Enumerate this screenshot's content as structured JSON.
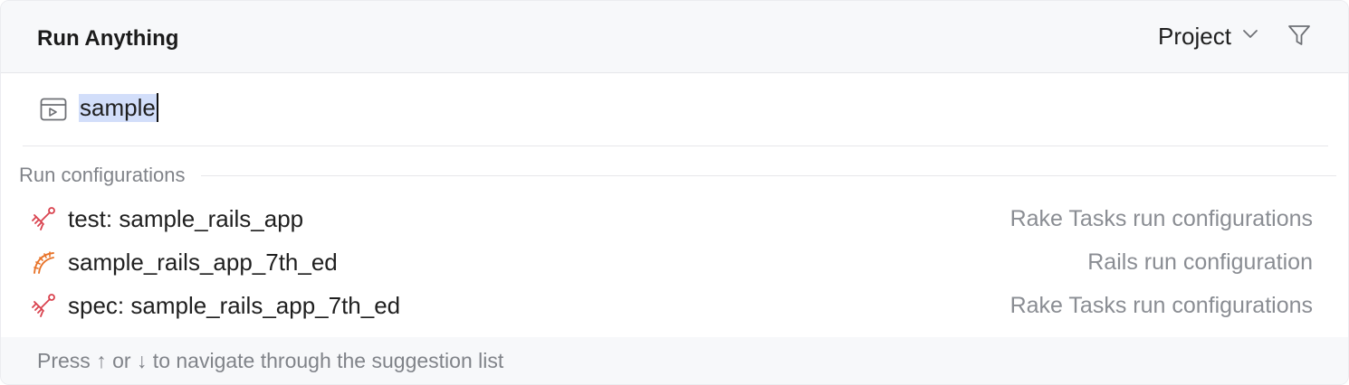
{
  "header": {
    "title": "Run Anything",
    "scope_label": "Project",
    "scope_icon": "chevron-down-icon",
    "filter_icon": "filter-icon"
  },
  "search": {
    "icon": "run-terminal-icon",
    "value": "sample"
  },
  "section": {
    "label": "Run configurations"
  },
  "items": [
    {
      "name": "test: sample_rails_app",
      "type": "Rake Tasks run configurations",
      "icon": "rake-icon",
      "icon_color": "#d9424e"
    },
    {
      "name": "sample_rails_app_7th_ed",
      "type": "Rails run configuration",
      "icon": "rails-icon",
      "icon_color": "#e8742a"
    },
    {
      "name": "spec: sample_rails_app_7th_ed",
      "type": "Rake Tasks run configurations",
      "icon": "rake-icon",
      "icon_color": "#d9424e"
    }
  ],
  "footer": {
    "hint": "Press ↑ or ↓ to navigate through the suggestion list"
  },
  "colors": {
    "selection": "#d2defa",
    "secondary_text": "#8a8d93",
    "header_bg": "#f7f8fa"
  }
}
